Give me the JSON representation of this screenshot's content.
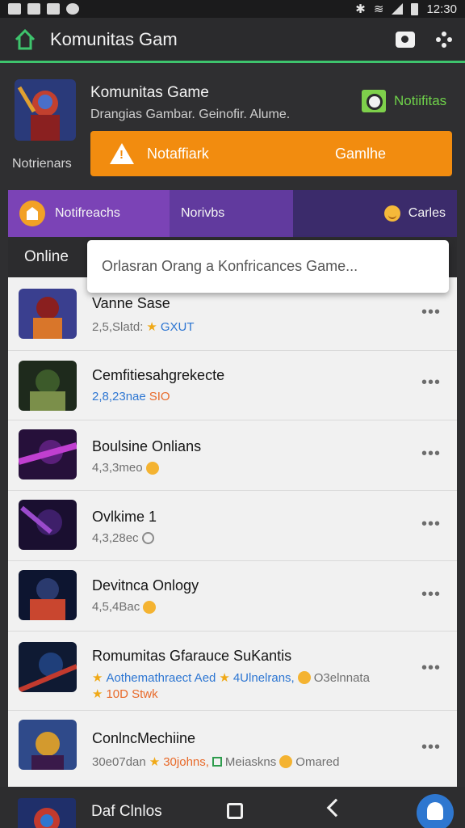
{
  "status_bar": {
    "time": "12:30"
  },
  "app_bar": {
    "title": "Komunitas Gam",
    "icons": [
      "home-icon",
      "camera-icon",
      "apps-grid-icon"
    ]
  },
  "header": {
    "game_name": "Komunitas Game",
    "subtitle": "Drangias Gambar. Geinofir. Alume.",
    "notifications_link": "Notiifitas",
    "side_label": "Notrienars",
    "alert_button": {
      "left_label": "Notaffiark",
      "right_label": "Gamlhe"
    }
  },
  "tabs": [
    {
      "label": "Notifreachs"
    },
    {
      "label": "Norivbs"
    },
    {
      "label": "Carles"
    }
  ],
  "online_label": "Online",
  "popup_text": "Orlasran Orang a Konfricances Game...",
  "games": [
    {
      "name": "Vanne Sase",
      "meta": "2,5,Slatd:",
      "meta_extra": "GXUT",
      "palette": [
        "#8a1f1f",
        "#d9762a",
        "#3a3f8f"
      ]
    },
    {
      "name": "Cemfitiesahgrekecte",
      "meta": "2,8,23nae",
      "meta_extra": "SIO",
      "palette": [
        "#3c5a2a",
        "#7b8f4a",
        "#1e2a1c"
      ]
    },
    {
      "name": "Boulsine Onlians",
      "meta": "4,3,3meo",
      "meta_extra": "",
      "palette": [
        "#5a1f7a",
        "#c03fd0",
        "#26103a"
      ]
    },
    {
      "name": "Ovlkime 1",
      "meta": "4,3,28ec",
      "meta_extra": "",
      "palette": [
        "#3e1f6a",
        "#9a4acb",
        "#1a0f30"
      ]
    },
    {
      "name": "Devitnca Onlogy",
      "meta": "4,5,4Bac",
      "meta_extra": "",
      "palette": [
        "#2a3a6e",
        "#c9462f",
        "#0d1530"
      ]
    },
    {
      "name": "Romumitas Gfarauce SuKantis",
      "meta": "Aothemathraect Aed",
      "meta_extra": "4Ulnelrans,",
      "meta_tail": "O3elnnata",
      "meta_line2": "10D Stwk",
      "palette": [
        "#1f3f7a",
        "#c23a2e",
        "#0f1a33"
      ]
    },
    {
      "name": "ConlncMechiine",
      "meta": "30e07dan",
      "meta_extra": "30johns,",
      "meta_tail": "Meiaskns",
      "meta_last": "Omared",
      "palette": [
        "#2f4a8a",
        "#d39a2e",
        "#3a1a4a"
      ]
    }
  ],
  "bottom_nav": {
    "label": "Daf Clnlos"
  },
  "colors": {
    "accent_green": "#3ec46d",
    "orange": "#f28c0f",
    "purple_tab": "#7b43b6"
  }
}
